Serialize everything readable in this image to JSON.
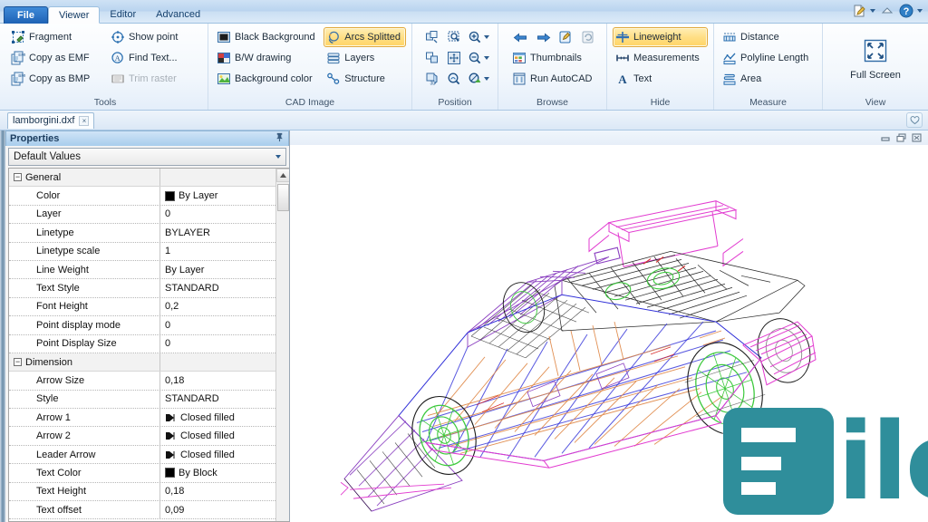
{
  "window": {
    "menu_tabs": [
      {
        "id": "file",
        "label": "File"
      },
      {
        "id": "viewer",
        "label": "Viewer"
      },
      {
        "id": "editor",
        "label": "Editor"
      },
      {
        "id": "advanced",
        "label": "Advanced"
      }
    ],
    "quick_access": [
      "edit-document-icon",
      "up-arrow-icon",
      "help-icon"
    ]
  },
  "ribbon": {
    "groups": [
      {
        "id": "tools",
        "label": "Tools",
        "columns": [
          [
            {
              "id": "fragment",
              "label": "Fragment",
              "icon": "fragment-icon",
              "state": "normal"
            },
            {
              "id": "copy-as-emf",
              "label": "Copy as EMF",
              "icon": "copy-emf-icon",
              "state": "normal"
            },
            {
              "id": "copy-as-bmp",
              "label": "Copy as BMP",
              "icon": "copy-bmp-icon",
              "state": "normal"
            }
          ],
          [
            {
              "id": "show-point",
              "label": "Show point",
              "icon": "show-point-icon",
              "state": "normal"
            },
            {
              "id": "find-text",
              "label": "Find Text...",
              "icon": "find-text-icon",
              "state": "normal"
            },
            {
              "id": "trim-raster",
              "label": "Trim raster",
              "icon": "trim-raster-icon",
              "state": "disabled"
            }
          ]
        ]
      },
      {
        "id": "cad-image",
        "label": "CAD Image",
        "columns": [
          [
            {
              "id": "black-background",
              "label": "Black Background",
              "icon": "black-background-icon",
              "state": "normal"
            },
            {
              "id": "bw-drawing",
              "label": "B/W drawing",
              "icon": "bw-drawing-icon",
              "state": "normal"
            },
            {
              "id": "background-color",
              "label": "Background color",
              "icon": "background-color-icon",
              "state": "normal"
            }
          ],
          [
            {
              "id": "arcs-splitted",
              "label": "Arcs Splitted",
              "icon": "arcs-splitted-icon",
              "state": "selected"
            },
            {
              "id": "layers",
              "label": "Layers",
              "icon": "layers-icon",
              "state": "normal"
            },
            {
              "id": "structure",
              "label": "Structure",
              "icon": "structure-icon",
              "state": "normal"
            }
          ]
        ]
      },
      {
        "id": "position",
        "label": "Position",
        "icon_rows": [
          [
            "pan-icon",
            "zoom-window-icon",
            "zoom-in-dropdown-icon"
          ],
          [
            "move-icon",
            "fit-to-window-icon",
            "zoom-out-dropdown-icon"
          ],
          [
            "rotate-3d-icon",
            "zoom-selection-icon",
            "zoom-preset-dropdown-icon"
          ]
        ]
      },
      {
        "id": "browse",
        "label": "Browse",
        "icon_row": [
          "previous-arrow-icon",
          "next-arrow-icon",
          "open-external-icon",
          "reload-icon"
        ],
        "items": [
          {
            "id": "thumbnails",
            "label": "Thumbnails",
            "icon": "thumbnails-icon",
            "state": "normal"
          },
          {
            "id": "run-autocad",
            "label": "Run AutoCAD",
            "icon": "run-autocad-icon",
            "state": "normal"
          }
        ]
      },
      {
        "id": "hide",
        "label": "Hide",
        "items": [
          {
            "id": "lineweight",
            "label": "Lineweight",
            "icon": "lineweight-icon",
            "state": "selected"
          },
          {
            "id": "measurements",
            "label": "Measurements",
            "icon": "measurements-icon",
            "state": "normal"
          },
          {
            "id": "text",
            "label": "Text",
            "icon": "text-icon",
            "state": "normal"
          }
        ]
      },
      {
        "id": "measure",
        "label": "Measure",
        "items": [
          {
            "id": "distance",
            "label": "Distance",
            "icon": "distance-icon",
            "state": "normal"
          },
          {
            "id": "polyline-length",
            "label": "Polyline Length",
            "icon": "polyline-length-icon",
            "state": "normal"
          },
          {
            "id": "area",
            "label": "Area",
            "icon": "area-icon",
            "state": "normal"
          }
        ]
      },
      {
        "id": "view",
        "label": "View",
        "big_button": {
          "id": "full-screen",
          "label": "Full Screen",
          "icon": "full-screen-icon"
        }
      }
    ]
  },
  "document_tabs": {
    "tabs": [
      {
        "id": "lamborgini",
        "label": "lamborgini.dxf",
        "close_label": "×"
      }
    ],
    "favorite_icon": "heart-icon"
  },
  "properties_panel": {
    "title": "Properties",
    "pin_icon": "pin-icon",
    "selector_value": "Default Values",
    "dropdown_icon": "chevron-down-icon",
    "rows": [
      {
        "type": "category",
        "name": "General",
        "value": "",
        "expanded": true
      },
      {
        "type": "prop",
        "name": "Color",
        "value": "By Layer",
        "swatch": "#000000"
      },
      {
        "type": "prop",
        "name": "Layer",
        "value": "0"
      },
      {
        "type": "prop",
        "name": "Linetype",
        "value": "BYLAYER"
      },
      {
        "type": "prop",
        "name": "Linetype scale",
        "value": "1"
      },
      {
        "type": "prop",
        "name": "Line Weight",
        "value": "By Layer"
      },
      {
        "type": "prop",
        "name": "Text Style",
        "value": "STANDARD"
      },
      {
        "type": "prop",
        "name": "Font Height",
        "value": "0,2"
      },
      {
        "type": "prop",
        "name": "Point display mode",
        "value": "0"
      },
      {
        "type": "prop",
        "name": "Point Display Size",
        "value": "0"
      },
      {
        "type": "category",
        "name": "Dimension",
        "value": "",
        "expanded": true
      },
      {
        "type": "prop",
        "name": "Arrow Size",
        "value": "0,18"
      },
      {
        "type": "prop",
        "name": "Style",
        "value": "STANDARD"
      },
      {
        "type": "prop",
        "name": "Arrow 1",
        "value": "Closed filled",
        "arrow": true
      },
      {
        "type": "prop",
        "name": "Arrow 2",
        "value": "Closed filled",
        "arrow": true
      },
      {
        "type": "prop",
        "name": "Leader Arrow",
        "value": "Closed filled",
        "arrow": true
      },
      {
        "type": "prop",
        "name": "Text Color",
        "value": "By Block",
        "swatch": "#000000"
      },
      {
        "type": "prop",
        "name": "Text Height",
        "value": "0,18"
      },
      {
        "type": "prop",
        "name": "Text offset",
        "value": "0,09"
      }
    ]
  },
  "drawing": {
    "mdi_buttons": [
      "minimize-icon",
      "restore-icon",
      "close-icon"
    ],
    "subject": "lamborghini 3d wireframe",
    "wire_colors": {
      "black": "#1b1b1b",
      "blue": "#3030d8",
      "purple": "#8a3fc0",
      "magenta": "#e23bd0",
      "orange": "#e08a4a",
      "green": "#3ec93e",
      "red": "#d83030",
      "gray": "#8a8a8a"
    }
  },
  "watermark": {
    "text": "ileCR",
    "logo_letter": "F",
    "color": "#2f8e9b"
  }
}
